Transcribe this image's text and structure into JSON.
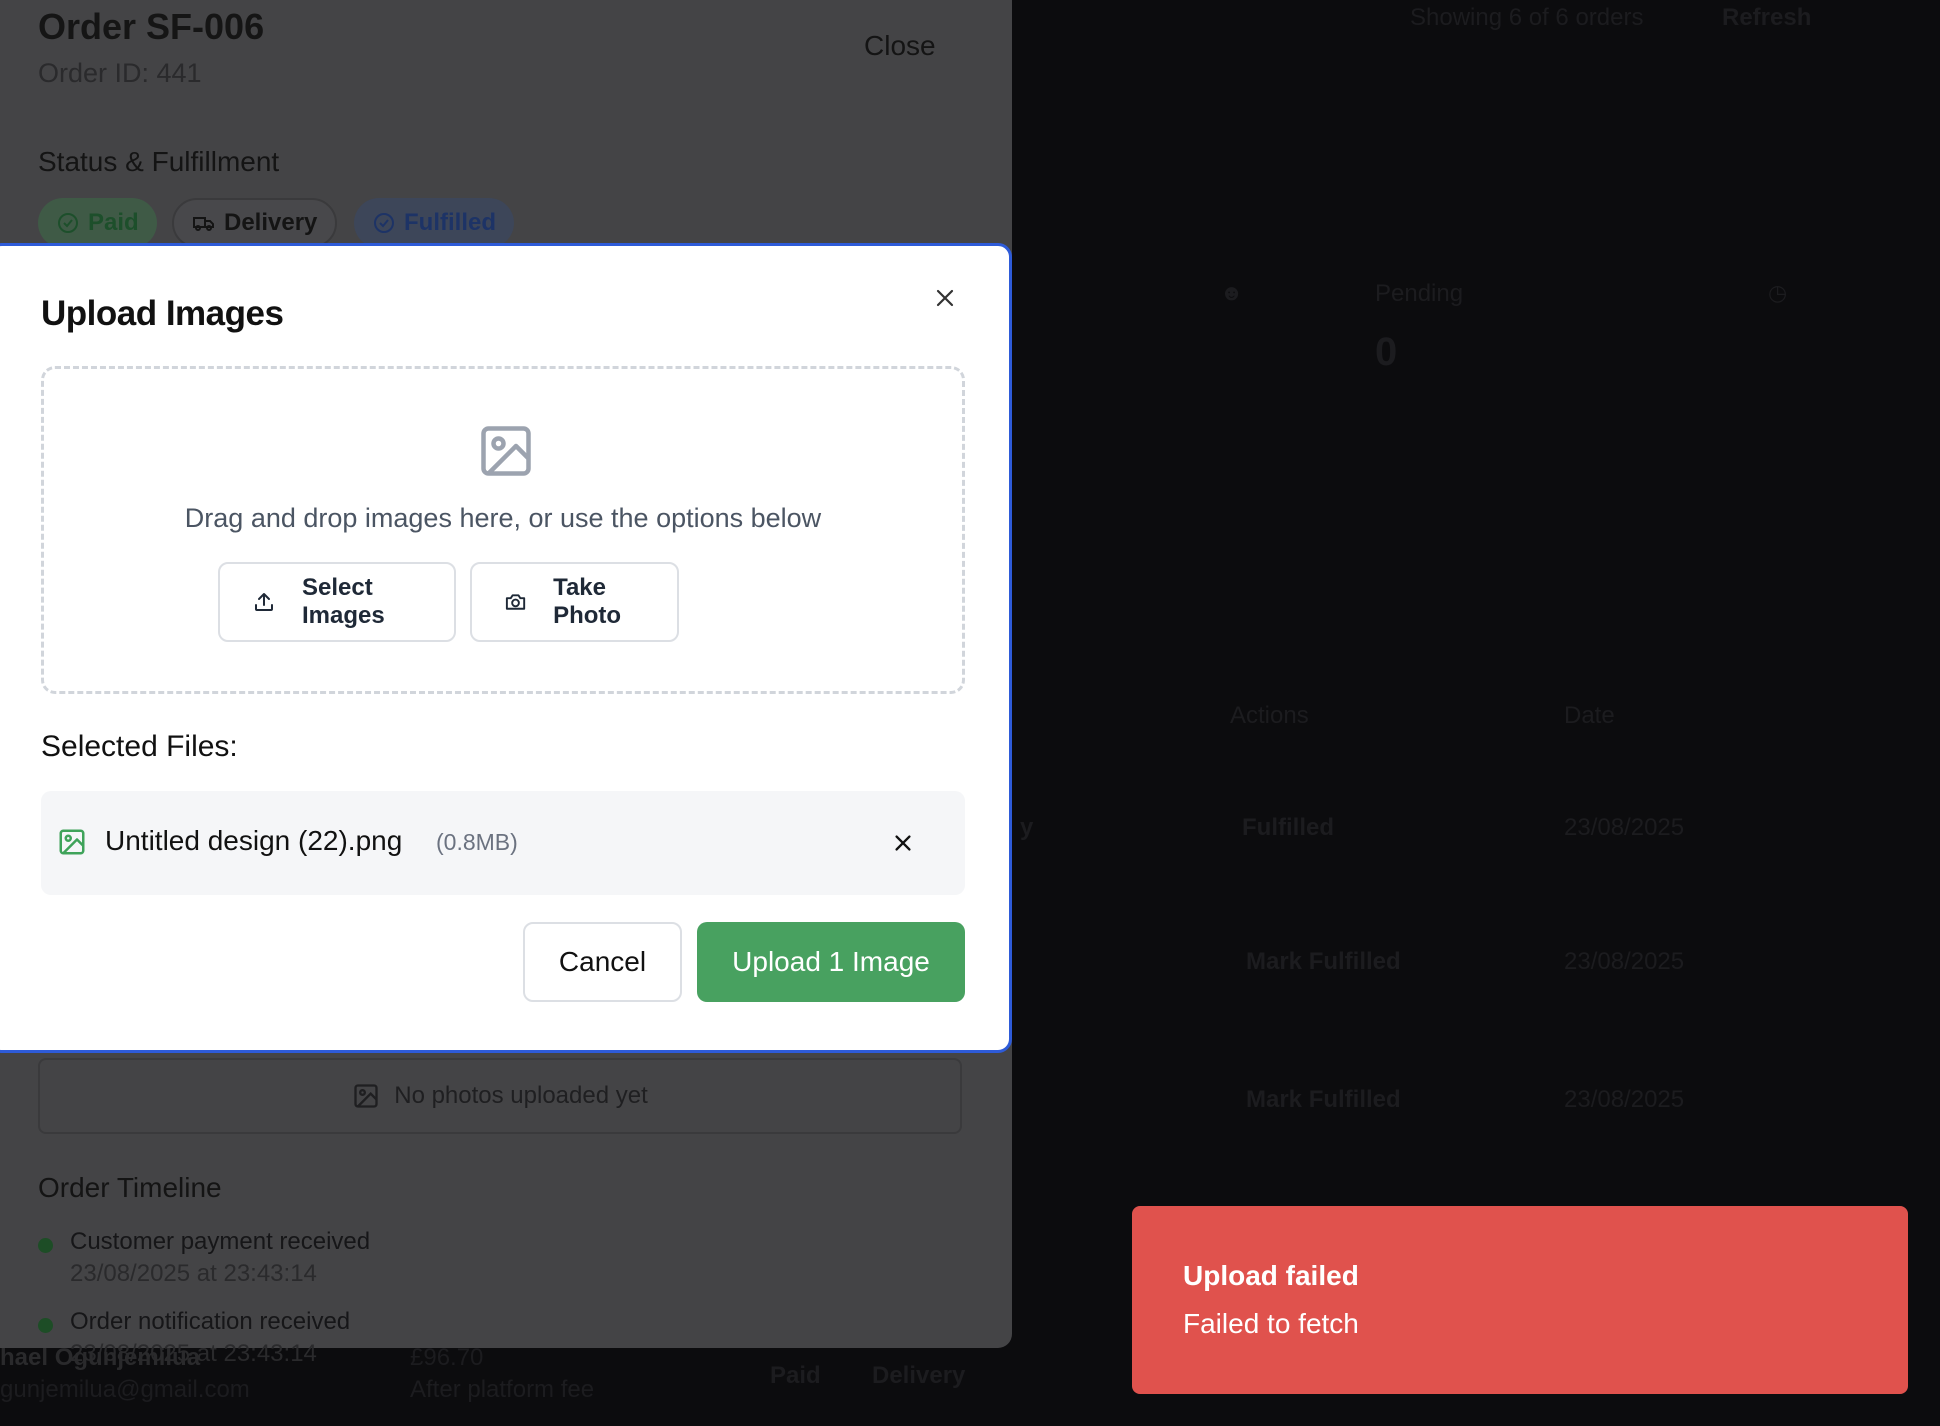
{
  "background": {
    "showing": "Showing 6 of 6 orders",
    "refresh": "Refresh",
    "stat_label": "Pending",
    "stat_value": "0",
    "col_actions": "Actions",
    "col_date": "Date",
    "partial_y": "y",
    "rows": [
      {
        "action": "Fulfilled",
        "date": "23/08/2025"
      },
      {
        "action": "Mark Fulfilled",
        "date": "23/08/2025"
      },
      {
        "action": "Mark Fulfilled",
        "date": "23/08/2025"
      }
    ],
    "bottom_row": {
      "customer": "hael Ogunjemilua",
      "email": "gunjemilua@gmail.com",
      "amount": "£96.70",
      "amount_note": "After platform fee",
      "payment": "Paid",
      "method": "Delivery"
    }
  },
  "drawer": {
    "title": "Order SF-006",
    "subtitle": "Order ID: 441",
    "close_label": "Close",
    "status_heading": "Status & Fulfillment",
    "pills": {
      "paid": "Paid",
      "delivery": "Delivery",
      "fulfilled": "Fulfilled"
    },
    "photos_empty": "No photos uploaded yet",
    "timeline_heading": "Order Timeline",
    "timeline": [
      {
        "label": "Customer payment received",
        "time": "23/08/2025 at 23:43:14"
      },
      {
        "label": "Order notification received",
        "time": "23/08/2025 at 23:43:14"
      }
    ]
  },
  "modal": {
    "title": "Upload Images",
    "dropzone_text": "Drag and drop images here, or use the options below",
    "select_images": "Select Images",
    "take_photo": "Take Photo",
    "selected_heading": "Selected Files:",
    "file": {
      "name": "Untitled design (22).png",
      "size": "(0.8MB)"
    },
    "cancel": "Cancel",
    "upload": "Upload 1 Image"
  },
  "toast": {
    "title": "Upload failed",
    "message": "Failed to fetch"
  },
  "colors": {
    "accent_border": "#2e5bd8",
    "upload_button": "#48a160",
    "toast_bg": "#e0524d",
    "file_icon": "#3fa35a"
  }
}
